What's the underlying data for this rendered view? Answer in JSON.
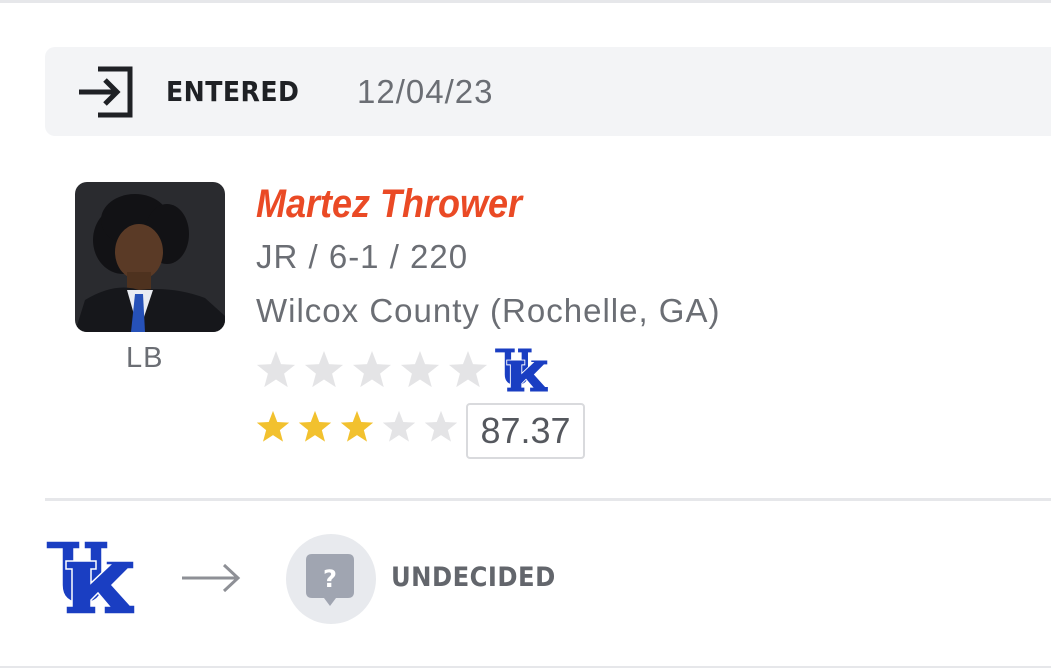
{
  "status": {
    "label": "ENTERED",
    "date": "12/04/23",
    "icon": "enter-portal-icon"
  },
  "player": {
    "name": "Martez Thrower",
    "meta": "JR / 6-1 / 220",
    "school": "Wilcox County (Rochelle, GA)",
    "position": "LB",
    "photo": "player-headshot"
  },
  "ratings": {
    "transfer_stars": 0,
    "transfer_stars_max": 5,
    "transfer_team_logo": "UK",
    "recruit_stars": 3,
    "recruit_stars_max": 5,
    "recruit_rating": "87.37"
  },
  "transfer": {
    "from_team_logo": "UK",
    "to_label": "UNDECIDED",
    "to_icon": "question-badge-icon",
    "arrow_icon": "arrow-right-icon"
  },
  "colors": {
    "name": "#ea4a25",
    "star_filled": "#f2c12e",
    "star_empty": "#e4e4e6",
    "uk_blue": "#1a3ec2",
    "status_bg": "#f3f4f6"
  }
}
